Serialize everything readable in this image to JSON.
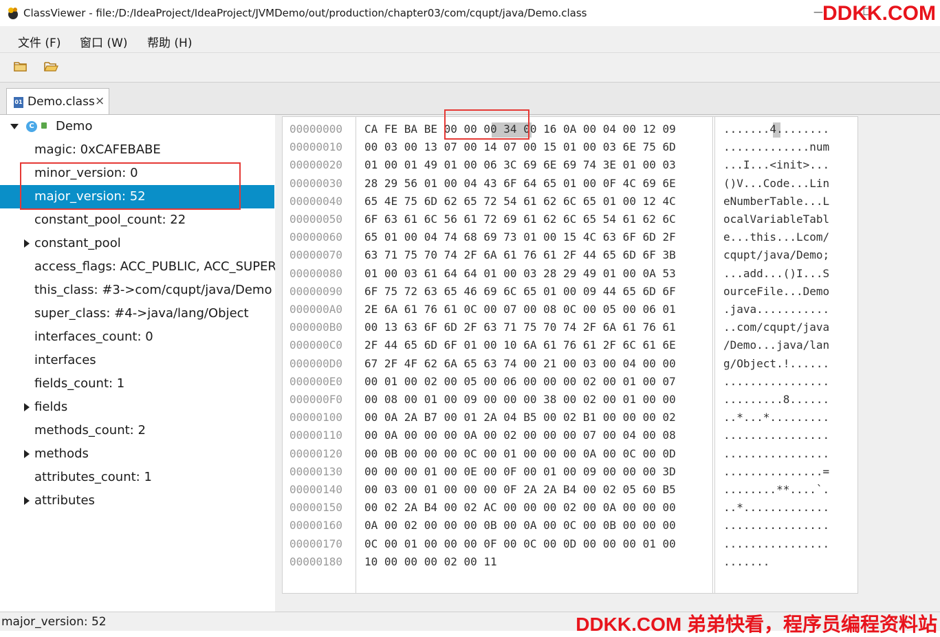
{
  "window": {
    "title": "ClassViewer - file:/D:/IdeaProject/IdeaProject/JVMDemo/out/production/chapter03/com/cqupt/java/Demo.class",
    "watermark_top": "DDKK.COM",
    "watermark_bottom": "DDKK.COM 弟弟快看，程序员编程资料站"
  },
  "menu": {
    "items": [
      {
        "label": "文件 (F)"
      },
      {
        "label": "窗口 (W)"
      },
      {
        "label": "帮助 (H)"
      }
    ]
  },
  "toolbar": {
    "buttons": [
      {
        "icon": "folder-icon"
      },
      {
        "icon": "folder-open-icon"
      }
    ]
  },
  "tab": {
    "icon_text": "01",
    "label": "Demo.class",
    "close": "×"
  },
  "tree": {
    "root": "Demo",
    "class_badge": "C",
    "items": [
      {
        "label": "magic: 0xCAFEBABE",
        "expandable": false
      },
      {
        "label": "minor_version: 0",
        "expandable": false
      },
      {
        "label": "major_version: 52",
        "expandable": false,
        "selected": true
      },
      {
        "label": "constant_pool_count: 22",
        "expandable": false
      },
      {
        "label": "constant_pool",
        "expandable": true
      },
      {
        "label": "access_flags: ACC_PUBLIC, ACC_SUPER",
        "expandable": false
      },
      {
        "label": "this_class: #3->com/cqupt/java/Demo",
        "expandable": false
      },
      {
        "label": "super_class: #4->java/lang/Object",
        "expandable": false
      },
      {
        "label": "interfaces_count: 0",
        "expandable": false
      },
      {
        "label": "interfaces",
        "expandable": false
      },
      {
        "label": "fields_count: 1",
        "expandable": false
      },
      {
        "label": "fields",
        "expandable": true
      },
      {
        "label": "methods_count: 2",
        "expandable": false
      },
      {
        "label": "methods",
        "expandable": true
      },
      {
        "label": "attributes_count: 1",
        "expandable": false
      },
      {
        "label": "attributes",
        "expandable": true
      }
    ]
  },
  "hex": {
    "rows": [
      {
        "addr": "00000000",
        "hex": "CA FE BA BE 00 00 00 34 00 16 0A 00 04 00 12 09",
        "ascii": ".......4........"
      },
      {
        "addr": "00000010",
        "hex": "00 03 00 13 07 00 14 07 00 15 01 00 03 6E 75 6D",
        "ascii": ".............num"
      },
      {
        "addr": "00000020",
        "hex": "01 00 01 49 01 00 06 3C 69 6E 69 74 3E 01 00 03",
        "ascii": "...I...<init>..."
      },
      {
        "addr": "00000030",
        "hex": "28 29 56 01 00 04 43 6F 64 65 01 00 0F 4C 69 6E",
        "ascii": "()V...Code...Lin"
      },
      {
        "addr": "00000040",
        "hex": "65 4E 75 6D 62 65 72 54 61 62 6C 65 01 00 12 4C",
        "ascii": "eNumberTable...L"
      },
      {
        "addr": "00000050",
        "hex": "6F 63 61 6C 56 61 72 69 61 62 6C 65 54 61 62 6C",
        "ascii": "ocalVariableTabl"
      },
      {
        "addr": "00000060",
        "hex": "65 01 00 04 74 68 69 73 01 00 15 4C 63 6F 6D 2F",
        "ascii": "e...this...Lcom/"
      },
      {
        "addr": "00000070",
        "hex": "63 71 75 70 74 2F 6A 61 76 61 2F 44 65 6D 6F 3B",
        "ascii": "cqupt/java/Demo;"
      },
      {
        "addr": "00000080",
        "hex": "01 00 03 61 64 64 01 00 03 28 29 49 01 00 0A 53",
        "ascii": "...add...()I...S"
      },
      {
        "addr": "00000090",
        "hex": "6F 75 72 63 65 46 69 6C 65 01 00 09 44 65 6D 6F",
        "ascii": "ourceFile...Demo"
      },
      {
        "addr": "000000A0",
        "hex": "2E 6A 61 76 61 0C 00 07 00 08 0C 00 05 00 06 01",
        "ascii": ".java..........."
      },
      {
        "addr": "000000B0",
        "hex": "00 13 63 6F 6D 2F 63 71 75 70 74 2F 6A 61 76 61",
        "ascii": "..com/cqupt/java"
      },
      {
        "addr": "000000C0",
        "hex": "2F 44 65 6D 6F 01 00 10 6A 61 76 61 2F 6C 61 6E",
        "ascii": "/Demo...java/lan"
      },
      {
        "addr": "000000D0",
        "hex": "67 2F 4F 62 6A 65 63 74 00 21 00 03 00 04 00 00",
        "ascii": "g/Object.!......"
      },
      {
        "addr": "000000E0",
        "hex": "00 01 00 02 00 05 00 06 00 00 00 02 00 01 00 07",
        "ascii": "................"
      },
      {
        "addr": "000000F0",
        "hex": "00 08 00 01 00 09 00 00 00 38 00 02 00 01 00 00",
        "ascii": ".........8......"
      },
      {
        "addr": "00000100",
        "hex": "00 0A 2A B7 00 01 2A 04 B5 00 02 B1 00 00 00 02",
        "ascii": "..*...*........."
      },
      {
        "addr": "00000110",
        "hex": "00 0A 00 00 00 0A 00 02 00 00 00 07 00 04 00 08",
        "ascii": "................"
      },
      {
        "addr": "00000120",
        "hex": "00 0B 00 00 00 0C 00 01 00 00 00 0A 00 0C 00 0D",
        "ascii": "................"
      },
      {
        "addr": "00000130",
        "hex": "00 00 00 01 00 0E 00 0F 00 01 00 09 00 00 00 3D",
        "ascii": "...............="
      },
      {
        "addr": "00000140",
        "hex": "00 03 00 01 00 00 00 0F 2A 2A B4 00 02 05 60 B5",
        "ascii": "........**....`."
      },
      {
        "addr": "00000150",
        "hex": "00 02 2A B4 00 02 AC 00 00 00 02 00 0A 00 00 00",
        "ascii": "..*............."
      },
      {
        "addr": "00000160",
        "hex": "0A 00 02 00 00 00 0B 00 0A 00 0C 00 0B 00 00 00",
        "ascii": "................"
      },
      {
        "addr": "00000170",
        "hex": "0C 00 01 00 00 00 0F 00 0C 00 0D 00 00 00 01 00",
        "ascii": "................"
      },
      {
        "addr": "00000180",
        "hex": "10 00 00 00 02 00 11",
        "ascii": "......."
      }
    ]
  },
  "status": {
    "text": "major_version: 52"
  }
}
